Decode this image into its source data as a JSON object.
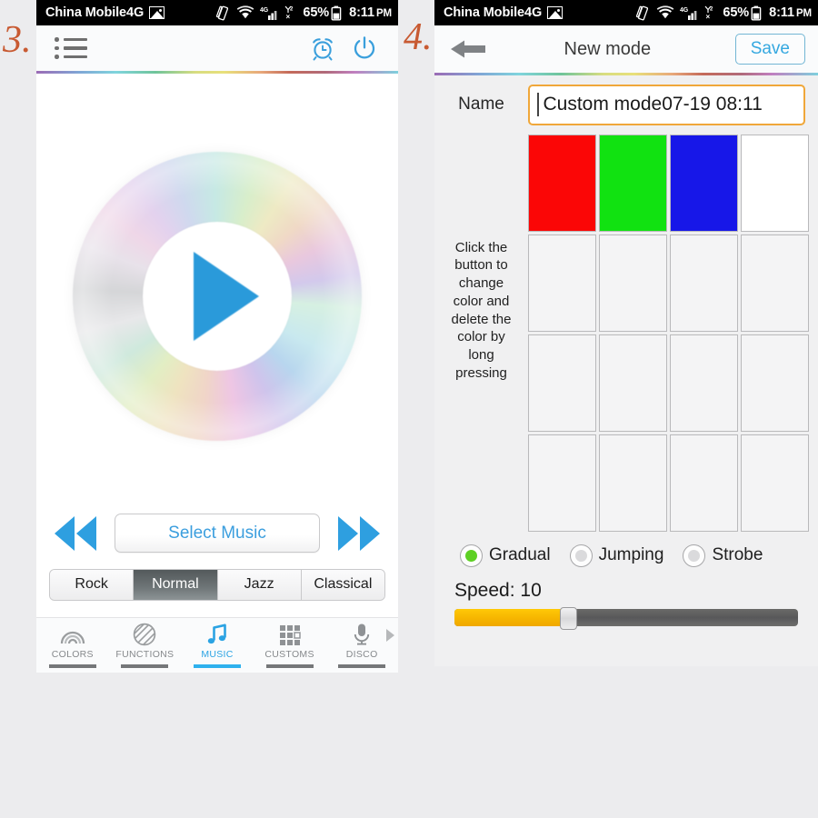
{
  "annotations": {
    "left": "3.",
    "right": "4."
  },
  "statusbar": {
    "carrier": "China Mobile4G",
    "battery": "65%",
    "time": "8:11",
    "ampm": "PM",
    "signal_4g": "4G",
    "signal_alt": "2"
  },
  "left_panel": {
    "header": {
      "menu_icon": "list-menu-icon",
      "alarm_icon": "alarm-clock-icon",
      "power_icon": "power-icon"
    },
    "player": {
      "disc_icon": "holographic-disc",
      "play_icon": "play-triangle-icon",
      "prev_icon": "rewind-icon",
      "next_icon": "fast-forward-icon",
      "select_music_label": "Select Music"
    },
    "genres": [
      {
        "label": "Rock",
        "active": false
      },
      {
        "label": "Normal",
        "active": true
      },
      {
        "label": "Jazz",
        "active": false
      },
      {
        "label": "Classical",
        "active": false
      }
    ],
    "tabs": [
      {
        "label": "COLORS",
        "icon": "rainbow-icon",
        "active": false
      },
      {
        "label": "FUNCTIONS",
        "icon": "striped-circle-icon",
        "active": false
      },
      {
        "label": "MUSIC",
        "icon": "music-note-icon",
        "active": true
      },
      {
        "label": "CUSTOMS",
        "icon": "grid-squares-icon",
        "active": false
      },
      {
        "label": "DISCO",
        "icon": "microphone-icon",
        "active": false
      }
    ],
    "tab_more_icon": "chevron-right-icon"
  },
  "right_panel": {
    "nav": {
      "back_icon": "back-arrow-icon",
      "title": "New mode",
      "save_label": "Save"
    },
    "name_field": {
      "label": "Name",
      "value": "Custom mode07-19 08:11"
    },
    "hint": "Click the button to change color and delete the color by long pressing",
    "swatches": [
      {
        "color": "#fb0606",
        "filled": true
      },
      {
        "color": "#11e211",
        "filled": true
      },
      {
        "color": "#1717e8",
        "filled": true
      },
      {
        "color": "#ffffff",
        "filled": true
      },
      {
        "color": "",
        "filled": false
      },
      {
        "color": "",
        "filled": false
      },
      {
        "color": "",
        "filled": false
      },
      {
        "color": "",
        "filled": false
      },
      {
        "color": "",
        "filled": false
      },
      {
        "color": "",
        "filled": false
      },
      {
        "color": "",
        "filled": false
      },
      {
        "color": "",
        "filled": false
      },
      {
        "color": "",
        "filled": false
      },
      {
        "color": "",
        "filled": false
      },
      {
        "color": "",
        "filled": false
      },
      {
        "color": "",
        "filled": false
      }
    ],
    "modes": [
      {
        "label": "Gradual",
        "checked": true
      },
      {
        "label": "Jumping",
        "checked": false
      },
      {
        "label": "Strobe",
        "checked": false
      }
    ],
    "speed": {
      "label": "Speed: 10",
      "value": 10,
      "fill_percent": 33
    }
  },
  "colors": {
    "accent_blue": "#2ba3e3",
    "save_blue": "#35a8e0",
    "field_orange": "#f0a73a",
    "slider_yellow": "#f6b500",
    "radio_green": "#5ed024",
    "annotation_orange": "#c85a32",
    "page_bg": "#ececee"
  }
}
